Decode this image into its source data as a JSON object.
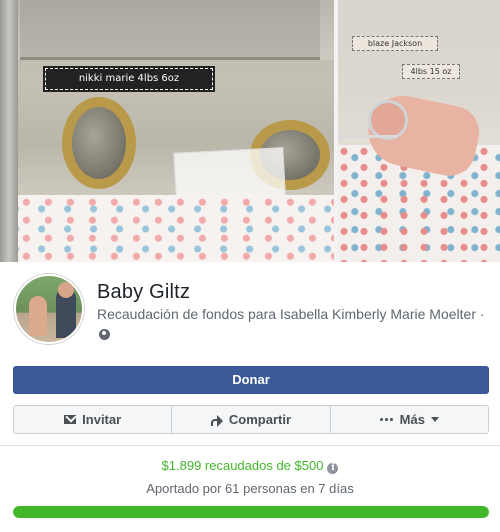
{
  "cover": {
    "left_label": "nikki marie 4lbs 6oz",
    "right_name_label": "blaze Jackson",
    "right_weight_label": "4lbs 15 oz"
  },
  "profile": {
    "page_name": "Baby Giltz",
    "fundraiser_text": "Recaudación de fondos para Isabella Kimberly Marie Moelter",
    "fundraiser_suffix": "·",
    "privacy_icon": "globe-icon"
  },
  "buttons": {
    "donate_label": "Donar",
    "invite_label": "Invitar",
    "share_label": "Compartir",
    "more_label": "Más"
  },
  "icons": {
    "invite": "envelope-icon",
    "share": "share-arrow-icon",
    "more": "dots-icon",
    "more_caret": "chevron-down-icon"
  },
  "progress": {
    "raised_text": "$1.899 recaudados de $500",
    "contributors_text": "Aportado por 61 personas en 7 días",
    "fill_fraction": 1.0
  },
  "colors": {
    "donate_bg": "#3b5998",
    "progress_green": "#42b72a"
  }
}
